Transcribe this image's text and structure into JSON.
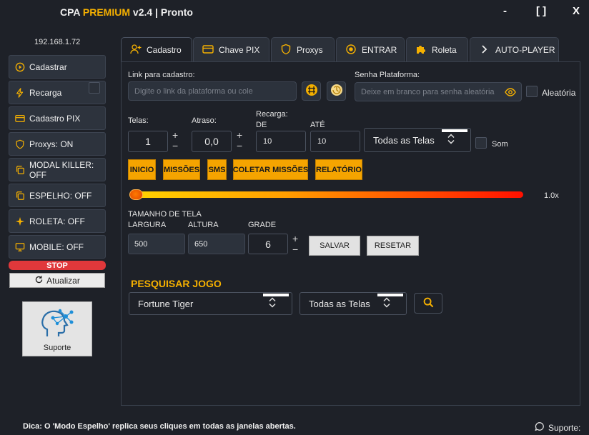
{
  "app": {
    "brand_prefix": "CPA",
    "brand_accent": "PREMIUM",
    "version": "v2.4",
    "separator": "|",
    "status": "Pronto",
    "minimize": "-",
    "maximize": "[ ]",
    "close": "X"
  },
  "sidebar": {
    "ip": "192.168.1.72",
    "buttons": {
      "cadastrar": "Cadastrar",
      "recarga": "Recarga",
      "cadastro_pix": "Cadastro PIX",
      "proxys": "Proxys: ON",
      "modal_killer": "MODAL KILLER: OFF",
      "espelho": "ESPELHO: OFF",
      "roleta": "ROLETA: OFF",
      "mobile": "MOBILE: OFF"
    },
    "stop": "STOP",
    "refresh": "Atualizar",
    "support": "Suporte"
  },
  "tabs": {
    "cadastro": "Cadastro",
    "chave_pix": "Chave PIX",
    "proxys": "Proxys",
    "entrar": "ENTRAR",
    "roleta": "Roleta",
    "auto_player": "AUTO-PLAYER"
  },
  "form": {
    "link_label": "Link para cadastro:",
    "link_placeholder": "Digite o link da plataforma ou cole",
    "senha_label": "Senha Plataforma:",
    "senha_placeholder": "Deixe em branco para senha aleatória",
    "aleatoria": "Aleatória",
    "telas_label": "Telas:",
    "telas_value": "1",
    "atraso_label": "Atraso:",
    "atraso_value": "0,0",
    "recarga_label": "Recarga:",
    "de_label": "DE",
    "de_value": "10",
    "ate_label": "ATÉ",
    "ate_value": "10",
    "telas_select": "Todas as Telas",
    "som": "Som",
    "plus": "+",
    "minus": "−"
  },
  "actions": {
    "inicio": "INICIO",
    "missoes": "MISSÕES",
    "sms": "SMS",
    "coletar": "COLETAR MISSÕES",
    "relatorio": "RELATÓRIO"
  },
  "slider": {
    "value": 0,
    "label": "1.0x"
  },
  "screen": {
    "title": "TAMANHO DE TELA",
    "largura_label": "LARGURA",
    "largura_value": "500",
    "altura_label": "ALTURA",
    "altura_value": "650",
    "grade_label": "GRADE",
    "grade_value": "6",
    "salvar": "SALVAR",
    "resetar": "RESETAR"
  },
  "search": {
    "title": "PESQUISAR JOGO",
    "game": "Fortune Tiger",
    "screens": "Todas as Telas"
  },
  "footer": {
    "tip": "Dica: O 'Modo Espelho' replica seus cliques em todas as janelas abertas.",
    "support": "Suporte:"
  },
  "colors": {
    "background": "#1e2128",
    "accent": "#f5b000",
    "action_button": "#f5a400",
    "stop": "#e0383b"
  },
  "icons": {
    "cadastrar": "play-circle-icon",
    "recarga": "lightning-icon",
    "cadastro_pix": "card-icon",
    "proxys": "shield-icon",
    "modal_killer": "copy-icon",
    "espelho": "copy-icon",
    "roleta": "sparkle-icon",
    "mobile": "monitor-icon",
    "refresh": "refresh-icon",
    "support": "brain-network-icon",
    "search": "search-icon",
    "eye": "eye-icon"
  }
}
